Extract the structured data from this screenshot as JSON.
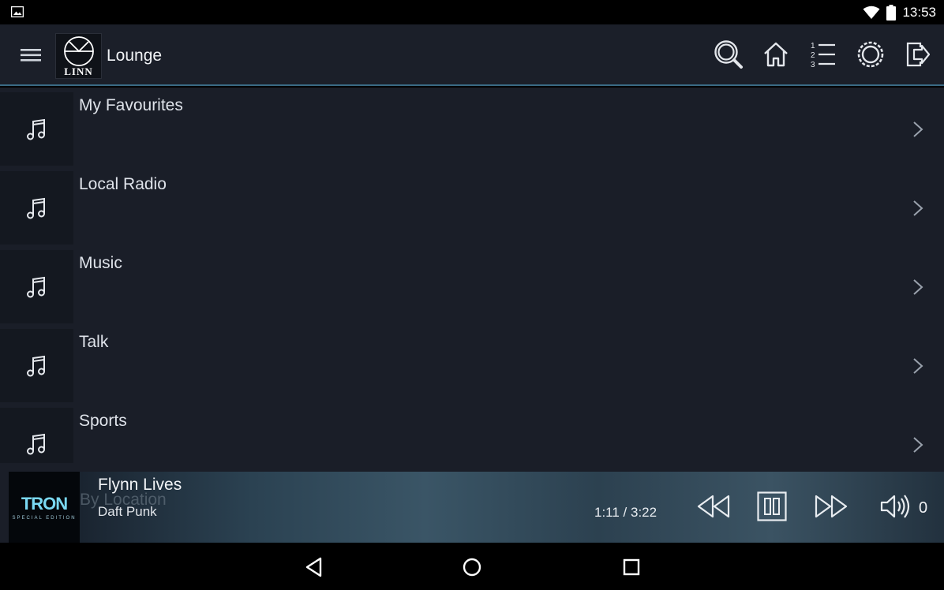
{
  "status_bar": {
    "time": "13:53",
    "icons": [
      "gallery-icon",
      "wifi-icon",
      "battery-icon"
    ]
  },
  "header": {
    "logo_text": "LINN",
    "room": "Lounge",
    "tools": [
      "search-icon",
      "home-icon",
      "playlist-icon",
      "settings-icon",
      "exit-icon"
    ]
  },
  "list": {
    "items": [
      {
        "label": "My Favourites",
        "icon": "music-note-icon"
      },
      {
        "label": "Local Radio",
        "icon": "music-note-icon"
      },
      {
        "label": "Music",
        "icon": "music-note-icon"
      },
      {
        "label": "Talk",
        "icon": "music-note-icon"
      },
      {
        "label": "Sports",
        "icon": "music-note-icon"
      }
    ],
    "partial_item": "By Location"
  },
  "now_playing": {
    "album_title": "TRON",
    "album_subtitle": "SPECIAL EDITION",
    "title": "Flynn Lives",
    "artist": "Daft Punk",
    "time": "1:11 / 3:22",
    "volume": "0"
  },
  "colors": {
    "header_bg": "#1b1f29",
    "list_bg": "#1a1e28",
    "accent_line": "#3a6a84"
  }
}
